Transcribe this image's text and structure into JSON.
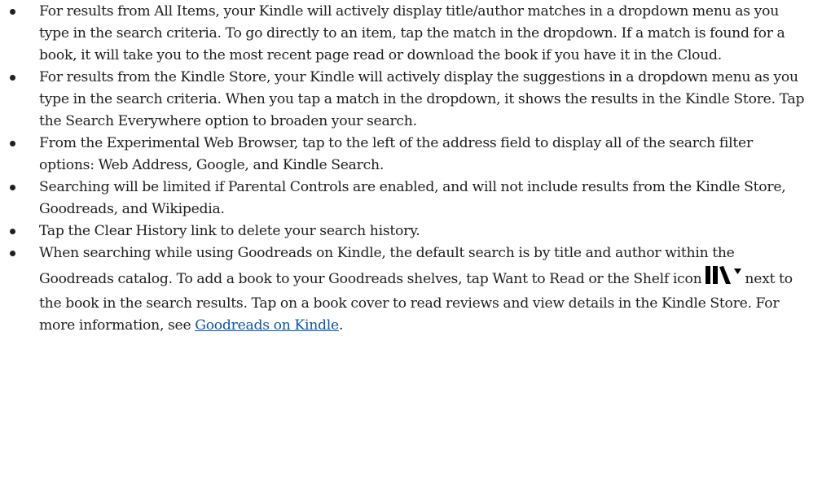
{
  "bullets": [
    {
      "text": "For results from All Items, your Kindle will actively display title/author matches in a dropdown menu as you type in the search criteria. To go directly to an item, tap the match in the dropdown. If a match is found for a book, it will take you to the most recent page read or download the book if you have it in the Cloud."
    },
    {
      "text": "For results from the Kindle Store, your Kindle will actively display the suggestions in a dropdown menu as you type in the search criteria. When you tap a match in the dropdown, it shows the results in the Kindle Store. Tap the Search Everywhere option to broaden your search."
    },
    {
      "text": "From the Experimental Web Browser, tap to the left of the address field to display all of the search filter options: Web Address, Google, and Kindle Search."
    },
    {
      "text": "Searching will be limited if Parental Controls are enabled, and will not include results from the Kindle Store, Goodreads, and Wikipedia."
    },
    {
      "text": "Tap the Clear History link to delete your search history."
    },
    {
      "text_before_icon": "When searching while using Goodreads on Kindle, the default search is by title and author within the Goodreads catalog. To add a book to your Goodreads shelves, tap Want to Read or the Shelf icon",
      "icon": "shelf-dropdown-icon",
      "text_after_icon": "next to the book in the search results. Tap on a book cover to read reviews and view details in the Kindle Store. For more information, see ",
      "link_text": "Goodreads on Kindle",
      "text_end": "."
    }
  ]
}
